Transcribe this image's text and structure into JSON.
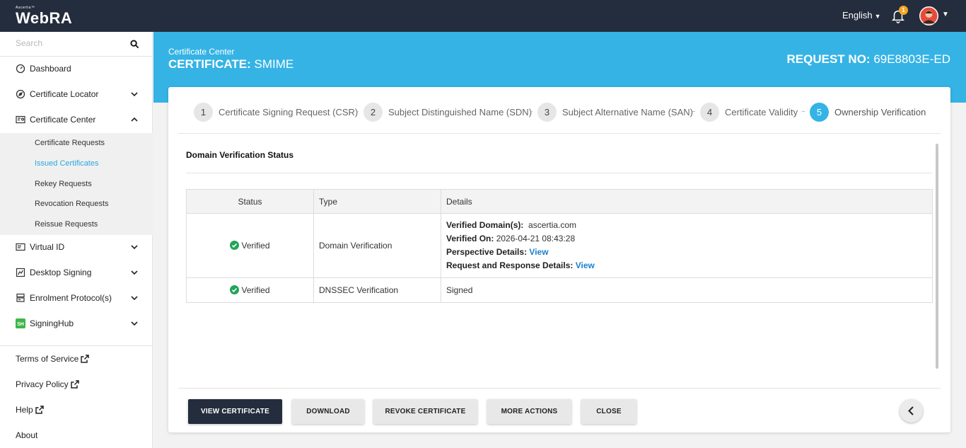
{
  "app": {
    "brand_small": "Ascertia™",
    "brand": "WebRA",
    "language": "English",
    "notification_count": "1"
  },
  "sidebar": {
    "search_placeholder": "Search",
    "items": [
      {
        "label": "Dashboard"
      },
      {
        "label": "Certificate Locator"
      },
      {
        "label": "Certificate Center"
      },
      {
        "label": "Virtual ID"
      },
      {
        "label": "Desktop Signing"
      },
      {
        "label": "Enrolment Protocol(s)"
      },
      {
        "label": "SigningHub"
      }
    ],
    "sub_items": [
      {
        "label": "Certificate Requests"
      },
      {
        "label": "Issued Certificates"
      },
      {
        "label": "Rekey Requests"
      },
      {
        "label": "Revocation Requests"
      },
      {
        "label": "Reissue Requests"
      }
    ],
    "footer": [
      {
        "label": "Terms of Service"
      },
      {
        "label": "Privacy Policy"
      },
      {
        "label": "Help"
      },
      {
        "label": "About"
      }
    ]
  },
  "header": {
    "breadcrumb": "Certificate Center",
    "title_prefix": "CERTIFICATE:",
    "title_value": "SMIME",
    "request_prefix": "REQUEST NO:",
    "request_value": "69E8803E-ED"
  },
  "steps": [
    {
      "num": "1",
      "label": "Certificate Signing Request (CSR)"
    },
    {
      "num": "2",
      "label": "Subject Distinguished Name (SDN)"
    },
    {
      "num": "3",
      "label": "Subject Alternative Name (SAN)"
    },
    {
      "num": "4",
      "label": "Certificate Validity"
    },
    {
      "num": "5",
      "label": "Ownership Verification"
    }
  ],
  "verification": {
    "section_title": "Domain Verification Status",
    "columns": [
      "Status",
      "Type",
      "Details"
    ],
    "rows": [
      {
        "status": "Verified",
        "type": "Domain Verification",
        "verified_domains_label": "Verified Domain(s):",
        "verified_domains_value": "ascertia.com",
        "verified_on_label": "Verified On:",
        "verified_on_value": "2026-04-21 08:43:28",
        "perspective_label": "Perspective Details:",
        "perspective_link": "View",
        "reqresp_label": "Request and Response Details:",
        "reqresp_link": "View"
      },
      {
        "status": "Verified",
        "type": "DNSSEC Verification",
        "details": "Signed"
      }
    ]
  },
  "actions": {
    "view_certificate": "VIEW CERTIFICATE",
    "download": "DOWNLOAD",
    "revoke_certificate": "REVOKE CERTIFICATE",
    "more_actions": "MORE ACTIONS",
    "close": "CLOSE"
  },
  "colors": {
    "topbar": "#242d3d",
    "accent": "#35b3e5",
    "active_link": "#2aa8dc",
    "verified": "#22a45a",
    "link": "#1a7fd0"
  }
}
